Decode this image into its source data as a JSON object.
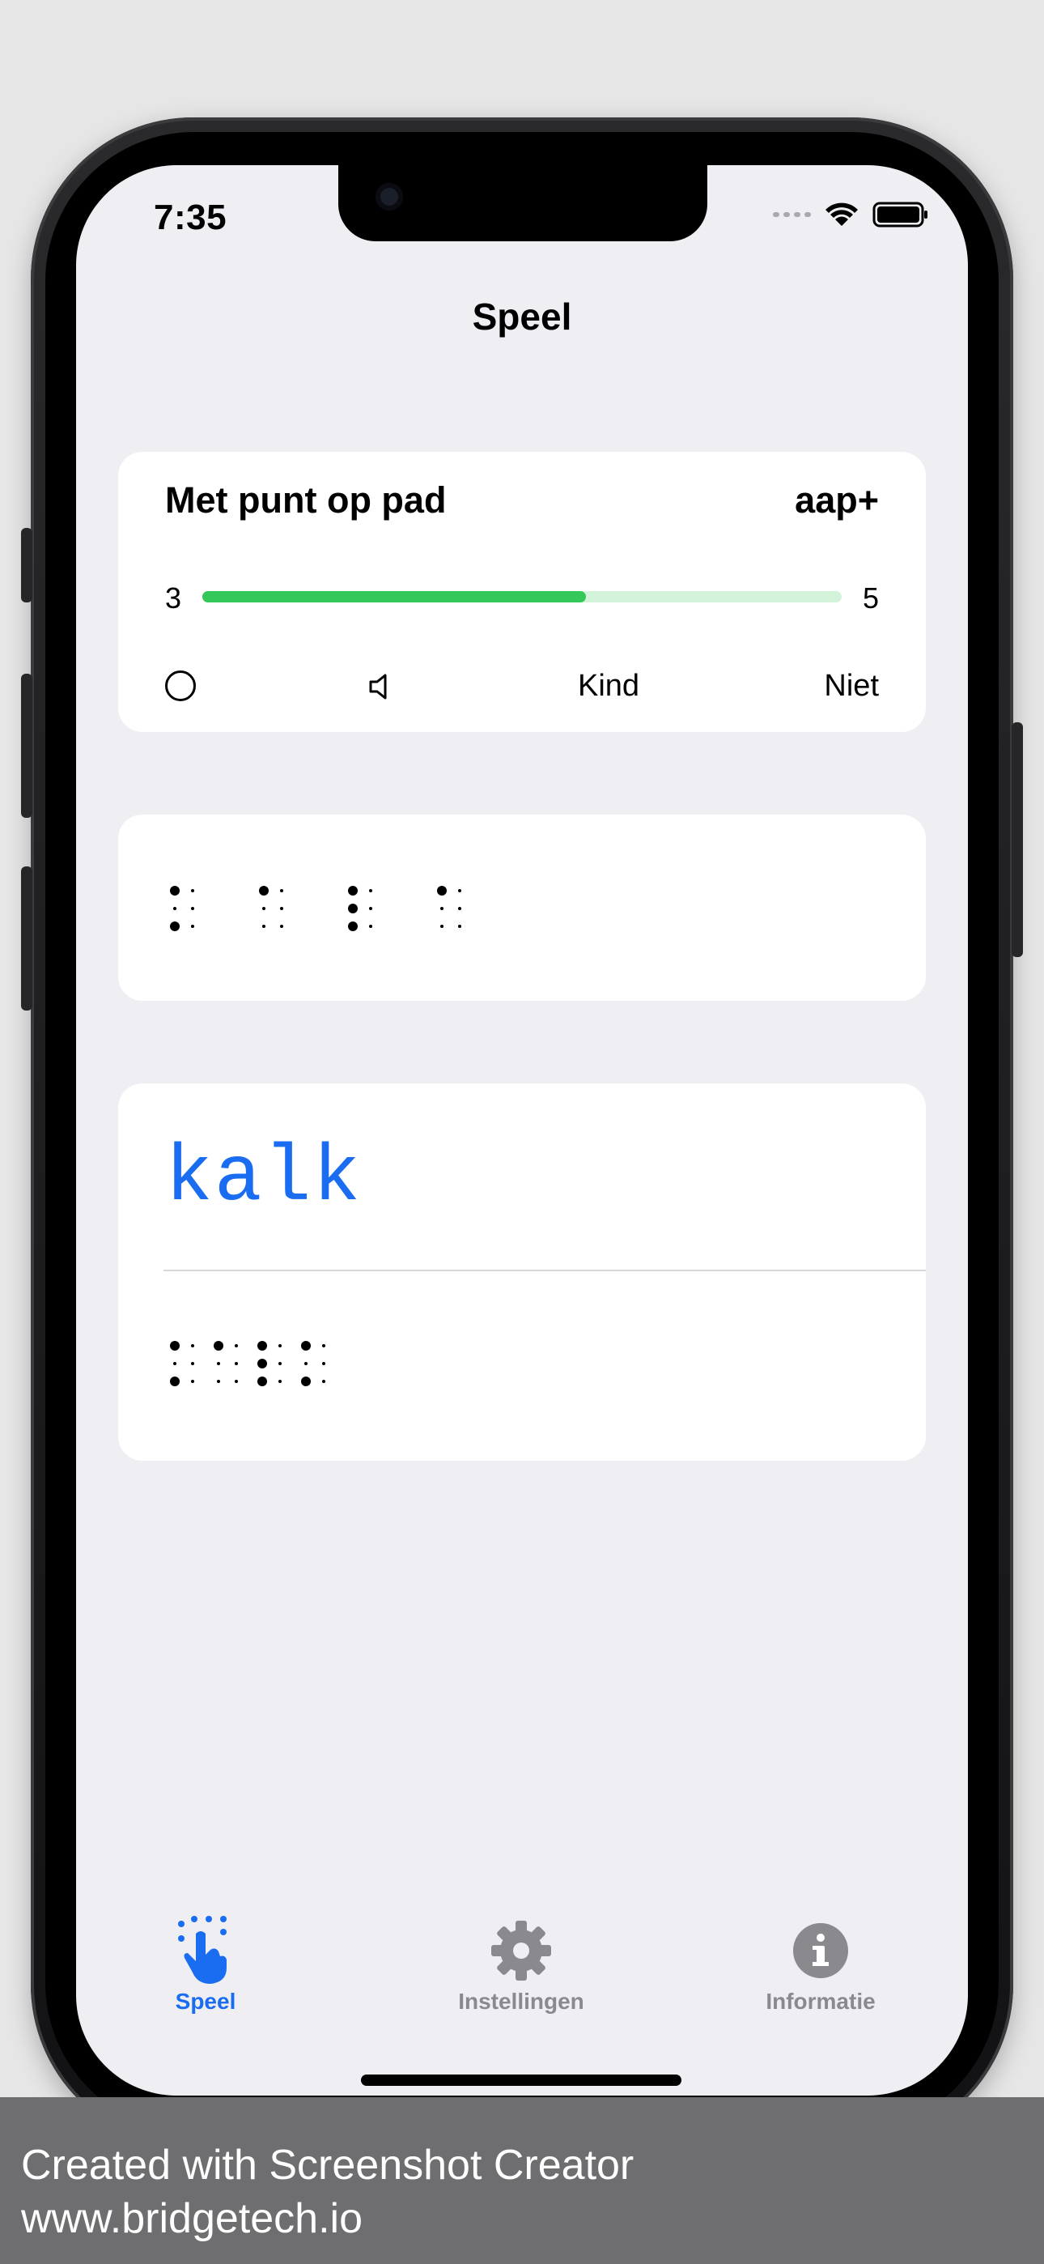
{
  "status_bar": {
    "time": "7:35"
  },
  "nav": {
    "title": "Speel"
  },
  "game_card": {
    "title": "Met punt op pad",
    "level": "aap+",
    "progress": {
      "min_label": "3",
      "max_label": "5",
      "fraction": 0.6
    },
    "controls": {
      "kind_label": "Kind",
      "niet_label": "Niet",
      "circle_icon": "circle-icon",
      "speaker_icon": "speaker-icon"
    }
  },
  "braille_prompt": {
    "cells": [
      [
        1,
        3
      ],
      [
        1
      ],
      [
        1,
        2,
        3
      ],
      [
        1
      ]
    ]
  },
  "answer_card": {
    "word": "kalk",
    "braille_cells": [
      [
        1,
        3
      ],
      [
        1
      ],
      [
        1,
        2,
        3
      ],
      [
        1,
        3
      ]
    ]
  },
  "tabbar": {
    "items": [
      {
        "label": "Speel",
        "icon": "hand-tap-icon",
        "active": true
      },
      {
        "label": "Instellingen",
        "icon": "gear-icon",
        "active": false
      },
      {
        "label": "Informatie",
        "icon": "info-icon",
        "active": false
      }
    ],
    "active_color": "#1a6cf0",
    "inactive_color": "#8a8a8e"
  },
  "footer": {
    "line1": "Created with Screenshot Creator",
    "line2": "www.bridgetech.io"
  },
  "colors": {
    "progress_fill": "#34c759",
    "progress_track": "#d2f3da",
    "word": "#1a6cf0",
    "background": "#efeef3"
  }
}
